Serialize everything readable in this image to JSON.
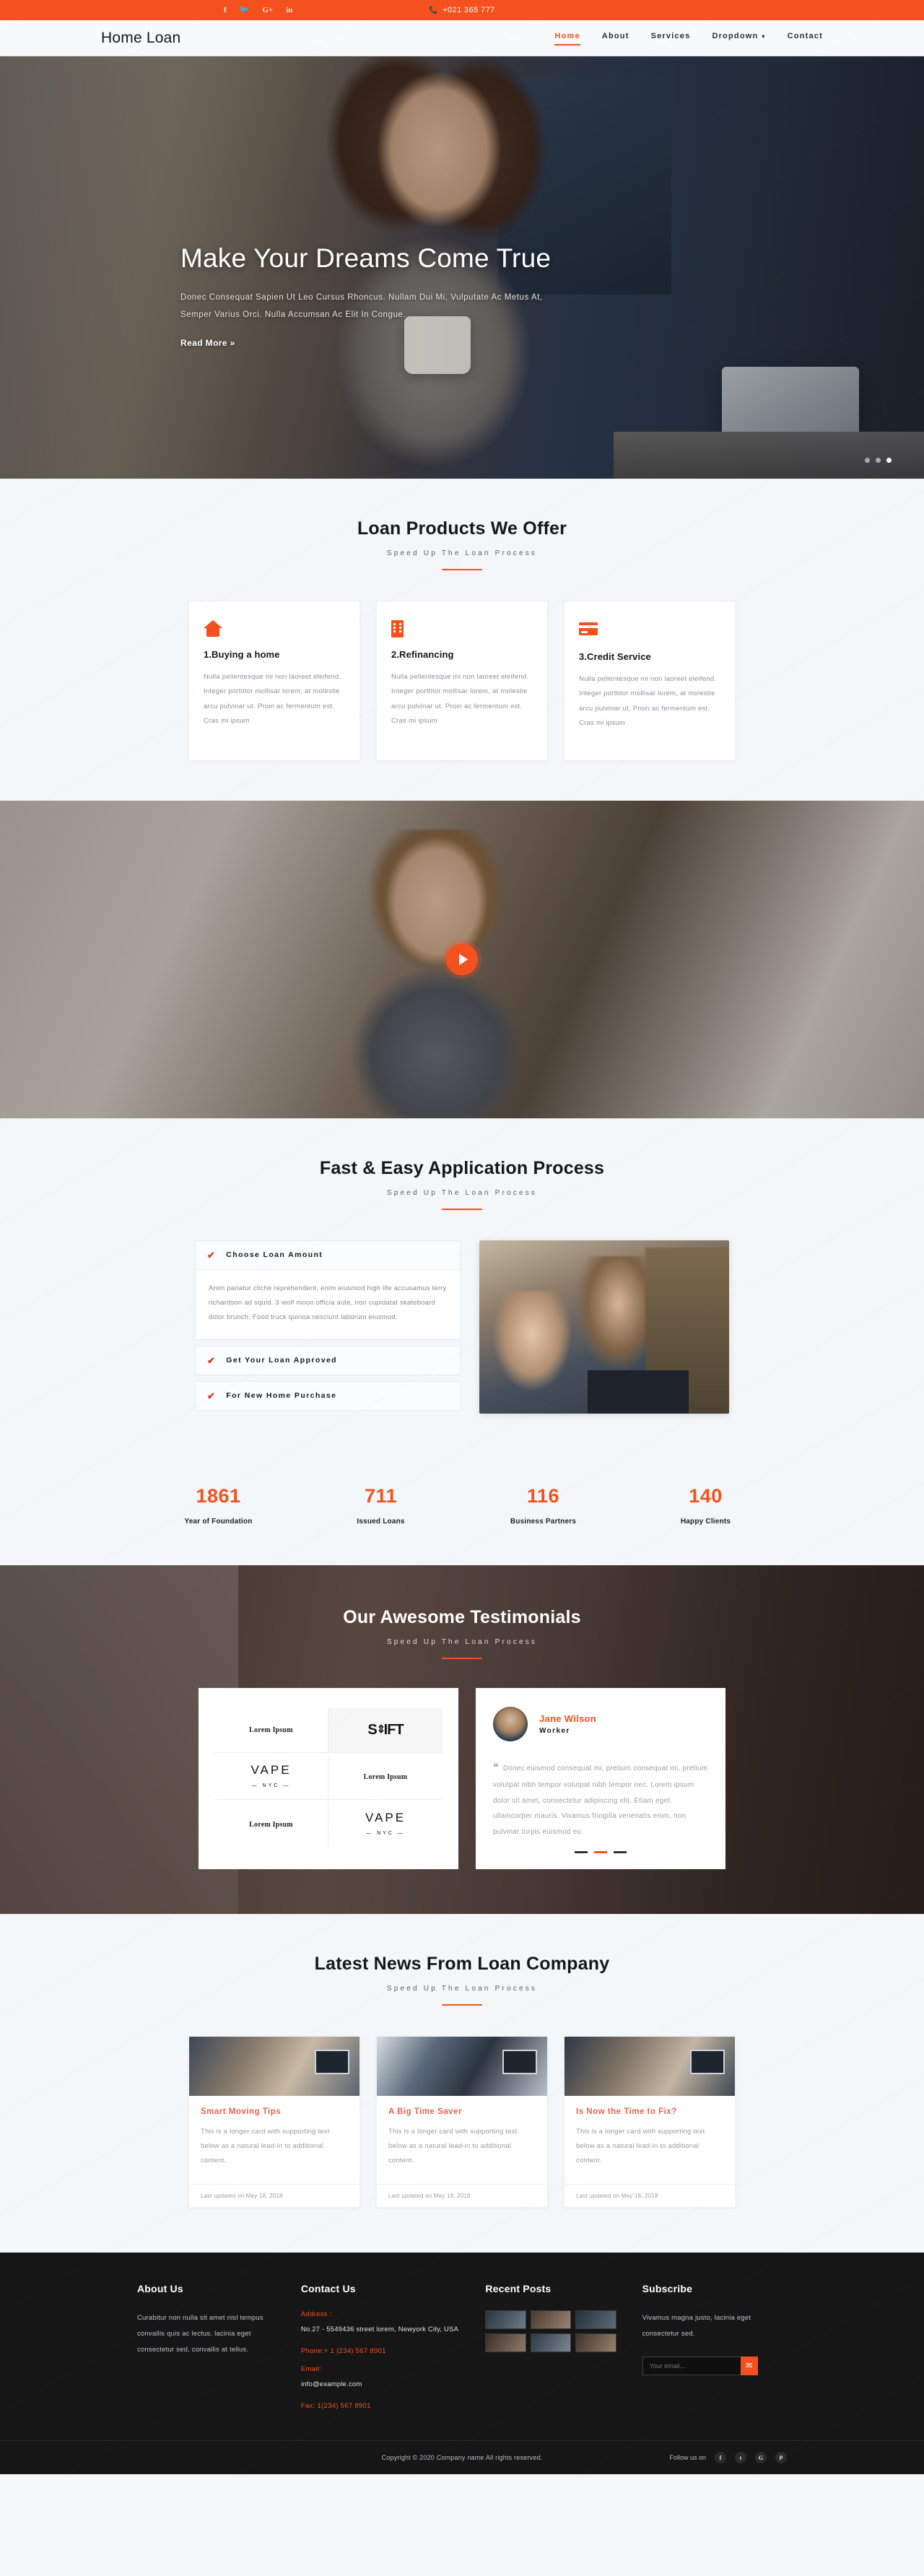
{
  "topbar": {
    "social": [
      {
        "name": "facebook-icon",
        "glyph": "f"
      },
      {
        "name": "twitter-icon",
        "glyph": "🐦"
      },
      {
        "name": "google-plus-icon",
        "glyph": "G+"
      },
      {
        "name": "linkedin-icon",
        "glyph": "in"
      }
    ],
    "phone_icon": "📞",
    "phone": "+021 365 777",
    "bg_color": "#f4511e"
  },
  "nav": {
    "brand": "Home Loan",
    "items": [
      {
        "label": "Home",
        "active": true
      },
      {
        "label": "About",
        "active": false
      },
      {
        "label": "Services",
        "active": false
      },
      {
        "label": "Dropdown",
        "active": false,
        "caret": "▾"
      },
      {
        "label": "Contact",
        "active": false
      }
    ]
  },
  "hero": {
    "title": "Make Your Dreams Come True",
    "subtitle": "Donec Consequat Sapien Ut Leo Cursus Rhoncus. Nullam Dui Mi, Vulputate Ac Metus At, Semper Varius Orci. Nulla Accumsan Ac Elit In Congue.",
    "cta": "Read More »",
    "dots": 3,
    "active_dot": 3
  },
  "products": {
    "title": "Loan Products We Offer",
    "subtitle": "Speed Up The Loan Process",
    "cards": [
      {
        "icon": "home-icon",
        "title": "1.Buying a home",
        "text": "Nulla pellentesque mi non laoreet eleifend. Integer porttitor mollisar lorem, at molestie arcu pulvinar ut. Proin ac fermentum est. Cras mi ipsum"
      },
      {
        "icon": "building-icon",
        "title": "2.Refinancing",
        "text": "Nulla pellentesque mi non laoreet eleifend. Integer porttitor mollisar lorem, at molestie arcu pulvinar ut. Proin ac fermentum est. Cras mi ipsum"
      },
      {
        "icon": "credit-card-icon",
        "title": "3.Credit Service",
        "text": "Nulla pellentesque mi non laoreet eleifend. Integer porttitor mollisar lorem, at molestie arcu pulvinar ut. Proin ac fermentum est. Cras mi ipsum"
      }
    ]
  },
  "video": {
    "play_label": "play-button"
  },
  "process": {
    "title": "Fast & Easy Application Process",
    "subtitle": "Speed Up The Loan Process",
    "accordion": [
      {
        "label": "Choose Loan Amount",
        "open": true,
        "body": "Anim pariatur cliche reprehenderit, enim eiusmod high life accusamus terry richardson ad squid. 3 wolf moon officia aute, non cupidatat skateboard dolor brunch. Food truck quinoa nesciunt laborum eiusmod."
      },
      {
        "label": "Get Your Loan Approved",
        "open": false,
        "body": ""
      },
      {
        "label": "For New Home Purchase",
        "open": false,
        "body": ""
      }
    ]
  },
  "stats": [
    {
      "num": "1861",
      "label": "Year of Foundation"
    },
    {
      "num": "711",
      "label": "Issued Loans"
    },
    {
      "num": "116",
      "label": "Business Partners"
    },
    {
      "num": "140",
      "label": "Happy Clients"
    }
  ],
  "testimonials": {
    "title": "Our Awesome Testimonials",
    "subtitle": "Speed Up The Loan Process",
    "logos": [
      {
        "type": "lorem",
        "text": "Lorem Ipsum",
        "highlight": false
      },
      {
        "type": "shift",
        "text": "SHIFT",
        "highlight": true
      },
      {
        "type": "vape",
        "text": "VAPE",
        "sub": "NYC",
        "highlight": false
      },
      {
        "type": "lorem",
        "text": "Lorem Ipsum",
        "highlight": false
      },
      {
        "type": "lorem",
        "text": "Lorem Ipsum",
        "highlight": false
      },
      {
        "type": "vape",
        "text": "VAPE",
        "sub": "NYC",
        "highlight": false
      }
    ],
    "quote": {
      "name": "Jane Wilson",
      "role": "Worker",
      "mark": "❝",
      "text": "Donec euismod consequat mi, pretium consequat mi, pretium volutpat nibh tempor volutpat nibh tempor nec. Lorem ipsum dolor sit amet, consectetur adipiscing elit. Etiam eget ullamcorper mauris. Vivamus fringilla venenatis enim, non pulvinar turpis euismod eu",
      "dots": 3,
      "active_dot": 2
    }
  },
  "blog": {
    "title": "Latest News From Loan Company",
    "subtitle": "Speed Up The Loan Process",
    "posts": [
      {
        "title": "Smart Moving Tips",
        "text": "This is a longer card with supporting text below as a natural lead-in to additional content.",
        "footer": "Last updated on May 18, 2018"
      },
      {
        "title": "A Big Time Saver",
        "text": "This is a longer card with supporting text below as a natural lead-in to additional content.",
        "footer": "Last updated on May 18, 2018"
      },
      {
        "title": "Is Now the Time to Fix?",
        "text": "This is a longer card with supporting text below as a natural lead-in to additional content.",
        "footer": "Last updated on May 18, 2018"
      }
    ]
  },
  "footer": {
    "about": {
      "title": "About Us",
      "text": "Curabitur non nulla sit amet nisl tempus convallis quis ac lectus. lacinia eget consectetur sed, convallis at tellus."
    },
    "contact": {
      "title": "Contact Us",
      "address_label": "Address :",
      "address": "No.27 - 5549436 street lorem, Newyork City, USA",
      "phone": "Phone:+ 1 (234) 567 8901",
      "email_label": "Email:",
      "email": "info@example.com",
      "fax": "Fax: 1(234) 567 8901"
    },
    "recent": {
      "title": "Recent Posts",
      "thumbs": [
        "thumb-1",
        "thumb-2",
        "thumb-3",
        "thumb-4",
        "thumb-5",
        "thumb-6"
      ]
    },
    "subscribe": {
      "title": "Subscribe",
      "text": "Vivamus magna justo, lacinia eget consectetur sed.",
      "placeholder": "Your email...",
      "button_icon": "✉"
    },
    "bottom": {
      "copyright": "Copyright © 2020 Company name All rights reserved.",
      "follow_label": "Follow us on",
      "social": [
        {
          "name": "facebook-icon",
          "glyph": "f"
        },
        {
          "name": "twitter-icon",
          "glyph": "t"
        },
        {
          "name": "google-plus-icon",
          "glyph": "G"
        },
        {
          "name": "pinterest-icon",
          "glyph": "P"
        }
      ]
    }
  }
}
